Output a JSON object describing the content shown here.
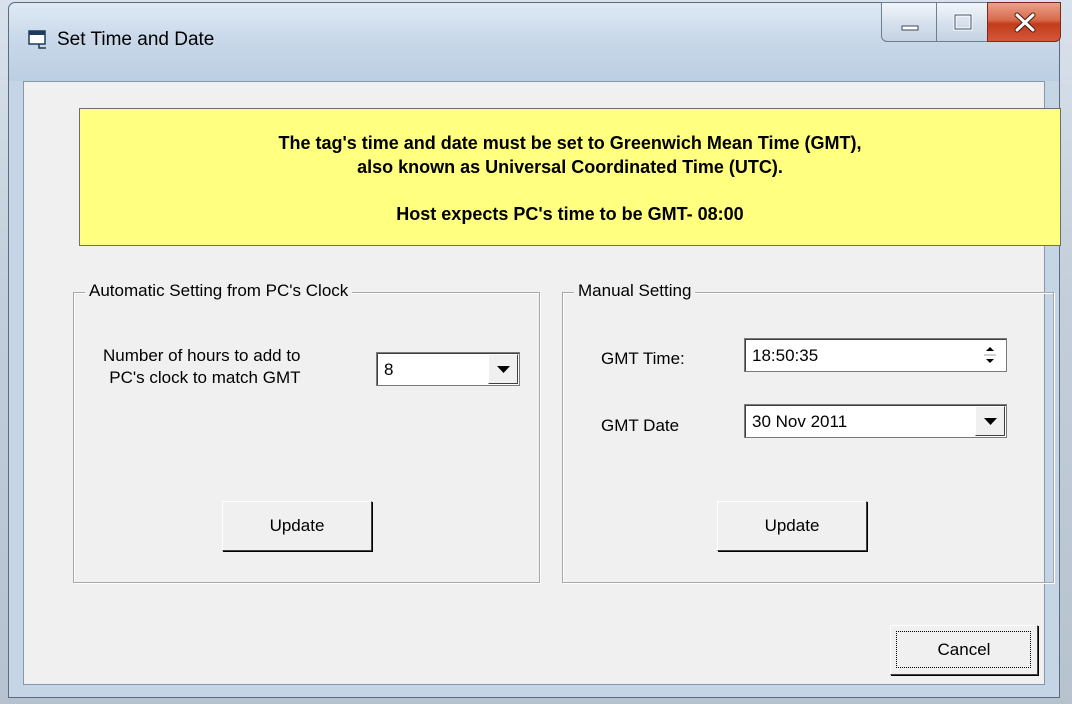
{
  "window": {
    "title": "Set Time and Date"
  },
  "banner": {
    "line1": "The tag's time and date must be set to Greenwich Mean Time (GMT),",
    "line2": "also known as Universal Coordinated Time (UTC).",
    "line3": "Host expects PC's time to be GMT- 08:00"
  },
  "auto": {
    "legend": "Automatic Setting from PC's Clock",
    "hours_label_1": "Number of hours to add to",
    "hours_label_2": "PC's clock to match GMT",
    "hours_value": "8",
    "update_label": "Update"
  },
  "manual": {
    "legend": "Manual Setting",
    "time_label": "GMT Time:",
    "time_value": "18:50:35",
    "date_label": "GMT Date",
    "date_value": "30 Nov 2011",
    "update_label": "Update"
  },
  "footer": {
    "cancel_label": "Cancel"
  },
  "colors": {
    "banner_bg": "#ffff80",
    "dialog_bg": "#f0f0f0",
    "close_button": "#c23c1c"
  },
  "icons": {
    "app": "window-app-icon",
    "minimize": "minimize-icon",
    "maximize": "maximize-icon",
    "close": "close-icon",
    "dropdown": "chevron-down-icon",
    "spinner": "spin-up-down-icon"
  }
}
